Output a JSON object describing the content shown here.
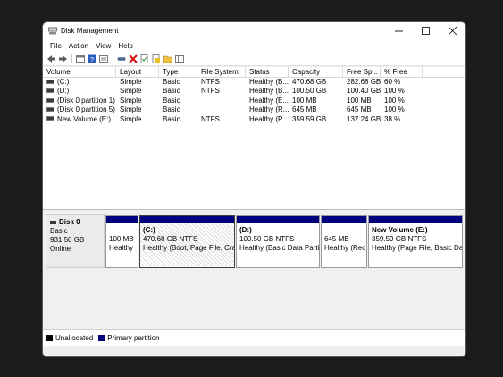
{
  "window": {
    "title": "Disk Management"
  },
  "menu": [
    "File",
    "Action",
    "View",
    "Help"
  ],
  "toolbar_icons": [
    "back-icon",
    "forward-icon",
    "properties-icon",
    "help-icon",
    "list-view-icon",
    "connect-icon",
    "delete-icon",
    "check-icon",
    "new-disk-icon",
    "folder-icon",
    "console-icon"
  ],
  "volumes": {
    "columns": [
      "Volume",
      "Layout",
      "Type",
      "File System",
      "Status",
      "Capacity",
      "Free Sp...",
      "% Free"
    ],
    "rows": [
      [
        "(C:)",
        "Simple",
        "Basic",
        "NTFS",
        "Healthy (B...",
        "470.68 GB",
        "282.68 GB",
        "60 %"
      ],
      [
        "(D:)",
        "Simple",
        "Basic",
        "NTFS",
        "Healthy (B...",
        "100.50 GB",
        "100.40 GB",
        "100 %"
      ],
      [
        "(Disk 0 partition 1)",
        "Simple",
        "Basic",
        "",
        "Healthy (E...",
        "100 MB",
        "100 MB",
        "100 %"
      ],
      [
        "(Disk 0 partition 5)",
        "Simple",
        "Basic",
        "",
        "Healthy (R...",
        "645 MB",
        "645 MB",
        "100 %"
      ],
      [
        "New Volume (E:)",
        "Simple",
        "Basic",
        "NTFS",
        "Healthy (P...",
        "359.59 GB",
        "137.24 GB",
        "38 %"
      ]
    ]
  },
  "disk": {
    "name": "Disk 0",
    "type": "Basic",
    "size": "931.50 GB",
    "status": "Online",
    "partitions": [
      {
        "title": "",
        "size": "100 MB",
        "status": "Healthy"
      },
      {
        "title": "(C:)",
        "size": "470.68 GB NTFS",
        "status": "Healthy (Boot, Page File, Cras"
      },
      {
        "title": "(D:)",
        "size": "100.50 GB NTFS",
        "status": "Healthy (Basic Data Partiti"
      },
      {
        "title": "",
        "size": "645 MB",
        "status": "Healthy (Rec"
      },
      {
        "title": "New Volume  (E:)",
        "size": "359.59 GB NTFS",
        "status": "Healthy (Page File, Basic Data"
      }
    ]
  },
  "legend": [
    {
      "label": "Unallocated",
      "color": "#000000"
    },
    {
      "label": "Primary partition",
      "color": "#00007f"
    }
  ]
}
